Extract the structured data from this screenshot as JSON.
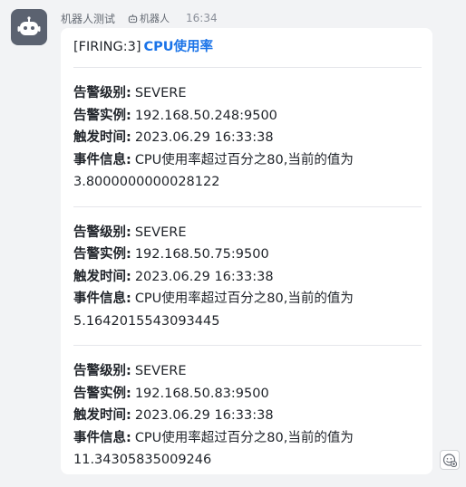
{
  "chat": {
    "sender_name": "机器人测试",
    "bot_badge": "机器人",
    "time": "16:34",
    "avatar_icon": "robot-icon",
    "badge_icon": "bot-icon",
    "reaction_icon": "add-reaction-icon"
  },
  "message": {
    "title_prefix": "[FIRING:3]",
    "title_keyword": "CPU使用率",
    "alerts": [
      {
        "level_key": "告警级别",
        "level_value": "SEVERE",
        "instance_key": "告警实例",
        "instance_value": "192.168.50.248:9500",
        "time_key": "触发时间",
        "time_value": "2023.06.29 16:33:38",
        "info_key": "事件信息",
        "info_value": "CPU使用率超过百分之80,当前的值为",
        "current_value": "3.8000000000028122"
      },
      {
        "level_key": "告警级别",
        "level_value": "SEVERE",
        "instance_key": "告警实例",
        "instance_value": "192.168.50.75:9500",
        "time_key": "触发时间",
        "time_value": "2023.06.29 16:33:38",
        "info_key": "事件信息",
        "info_value": "CPU使用率超过百分之80,当前的值为",
        "current_value": "5.1642015543093445"
      },
      {
        "level_key": "告警级别",
        "level_value": "SEVERE",
        "instance_key": "告警实例",
        "instance_value": "192.168.50.83:9500",
        "time_key": "触发时间",
        "time_value": "2023.06.29 16:33:38",
        "info_key": "事件信息",
        "info_value": "CPU使用率超过百分之80,当前的值为",
        "current_value": "11.34305835009246"
      }
    ]
  },
  "colors": {
    "background": "#f2f3f5",
    "bubble": "#ffffff",
    "accent": "#1a73e8",
    "text": "#1f2329",
    "meta_text": "#8a8f99",
    "avatar": "#5b6270"
  }
}
